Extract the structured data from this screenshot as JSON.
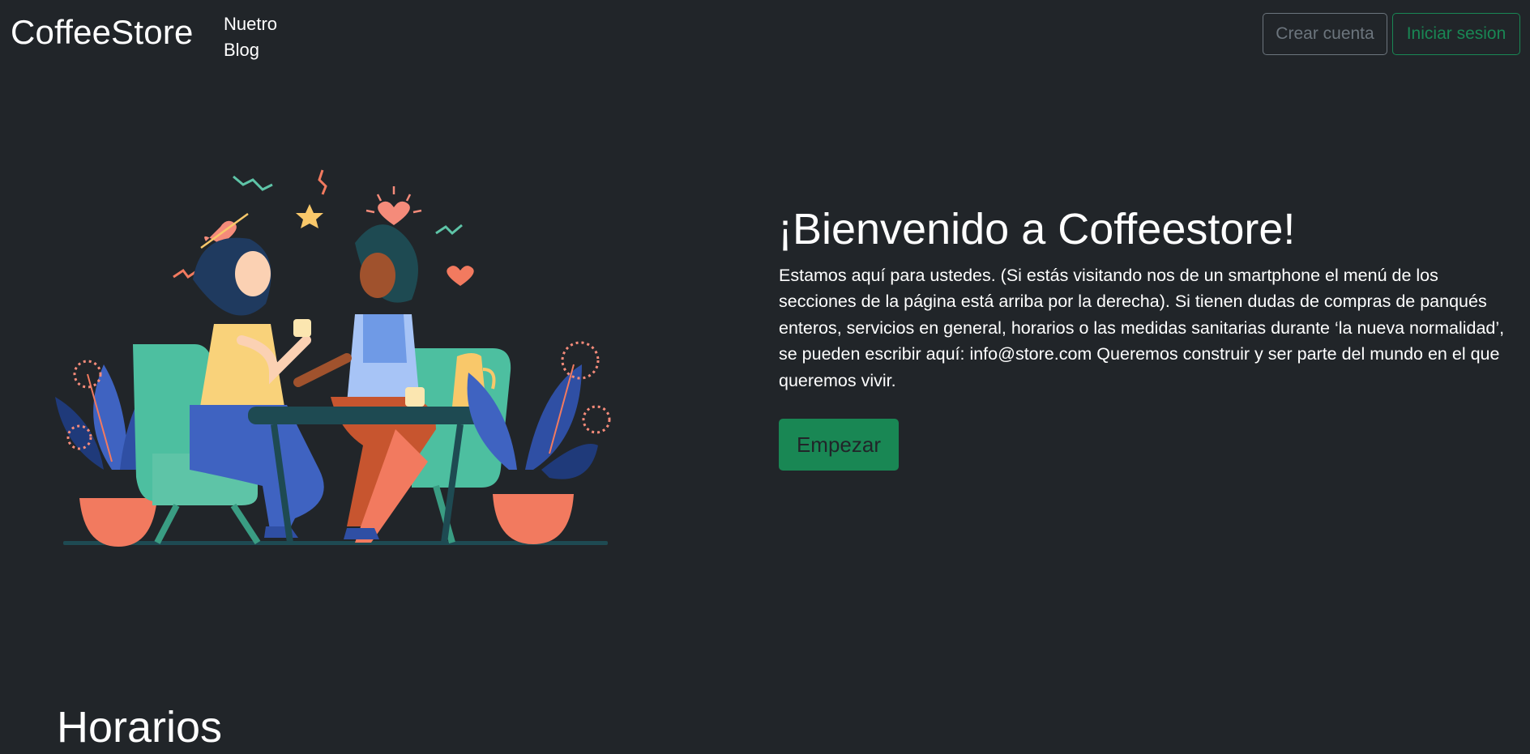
{
  "navbar": {
    "brand": "CoffeeStore",
    "nav_link": "Nuetro Blog",
    "create_account": "Crear cuenta",
    "login": "Iniciar sesion"
  },
  "hero": {
    "title": "¡Bienvenido a Coffeestore!",
    "text": "Estamos aquí para ustedes. (Si estás visitando nos de un smartphone el menú de los secciones de la página está arriba por la derecha). Si tienen dudas de compras de panqués enteros, servicios en general, horarios o las medidas sanitarias durante ‘la nueva normalidad’, se pueden escribir aquí: info@store.com Queremos construir y ser parte del mundo en el que queremos vivir.",
    "cta": "Empezar",
    "illustration_icon": "coffee-friends-illustration"
  },
  "sections": {
    "schedule_title": "Horarios"
  },
  "colors": {
    "background": "#212529",
    "success": "#198754",
    "secondary": "#6c757d"
  }
}
